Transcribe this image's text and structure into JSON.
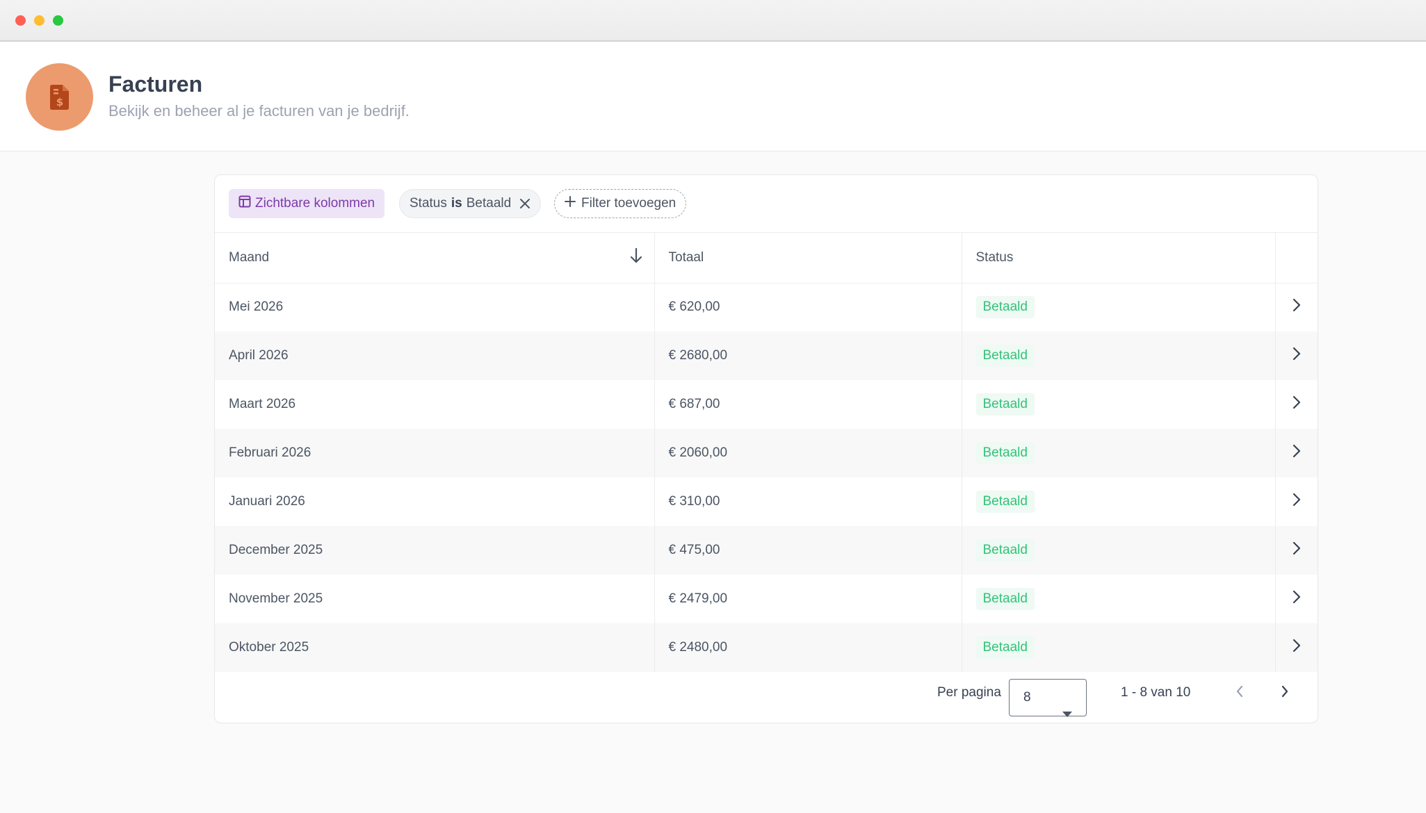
{
  "header": {
    "title": "Facturen",
    "subtitle": "Bekijk en beheer al je facturen van je bedrijf.",
    "icon": "invoice-icon",
    "accent_color": "#ec9b6e"
  },
  "toolbar": {
    "columns_label": "Zichtbare kolommen",
    "filter_field": "Status",
    "filter_operator": "is",
    "filter_value": "Betaald",
    "add_filter_label": "Filter toevoegen"
  },
  "table": {
    "columns": [
      "Maand",
      "Totaal",
      "Status"
    ],
    "sort_column": "Maand",
    "sort_direction": "descending",
    "rows": [
      {
        "month": "Mei 2026",
        "total": "€ 620,00",
        "status": "Betaald"
      },
      {
        "month": "April 2026",
        "total": "€ 2680,00",
        "status": "Betaald"
      },
      {
        "month": "Maart 2026",
        "total": "€ 687,00",
        "status": "Betaald"
      },
      {
        "month": "Februari 2026",
        "total": "€ 2060,00",
        "status": "Betaald"
      },
      {
        "month": "Januari 2026",
        "total": "€ 310,00",
        "status": "Betaald"
      },
      {
        "month": "December 2025",
        "total": "€ 475,00",
        "status": "Betaald"
      },
      {
        "month": "November 2025",
        "total": "€ 2479,00",
        "status": "Betaald"
      },
      {
        "month": "Oktober 2025",
        "total": "€ 2480,00",
        "status": "Betaald"
      }
    ],
    "status_color": "#34c27a"
  },
  "pagination": {
    "per_page_label": "Per pagina",
    "per_page_value": "8",
    "range_text": "1 - 8 van 10"
  }
}
